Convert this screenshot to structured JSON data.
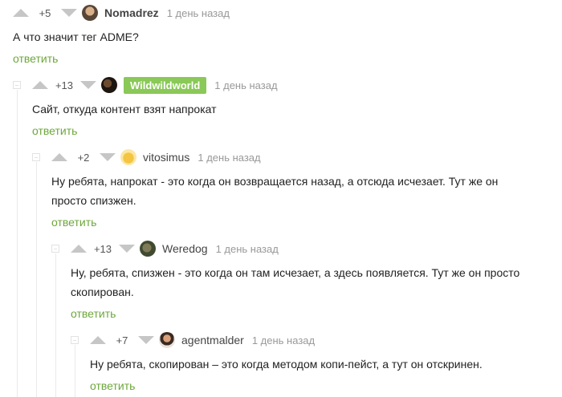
{
  "comments": [
    {
      "rating": "+5",
      "author": "Nomadrez",
      "time": "1 день назад",
      "text": "А что значит тег ADME?",
      "reply": "ответить"
    },
    {
      "rating": "+13",
      "author": "Wildwildworld",
      "time": "1 день назад",
      "text": "Сайт, откуда контент взят напрокат",
      "reply": "ответить"
    },
    {
      "rating": "+2",
      "author": "vitosimus",
      "time": "1 день назад",
      "text": "Ну ребята, напрокат - это когда он возвращается назад, а отсюда исчезает. Тут же он просто спизжен.",
      "reply": "ответить"
    },
    {
      "rating": "+13",
      "author": "Weredog",
      "time": "1 день назад",
      "text": "Ну, ребята, спизжен - это когда он там исчезает, а здесь появляется. Тут же он просто скопирован.",
      "reply": "ответить"
    },
    {
      "rating": "+7",
      "author": "agentmalder",
      "time": "1 день назад",
      "text": "Ну ребята, скопирован – это когда методом копи-пейст, а тут он отскринен.",
      "reply": "ответить"
    }
  ],
  "colors": {
    "reply": "#6ea73b",
    "badge": "#8ac858",
    "arrow": "#c6c6c6"
  }
}
